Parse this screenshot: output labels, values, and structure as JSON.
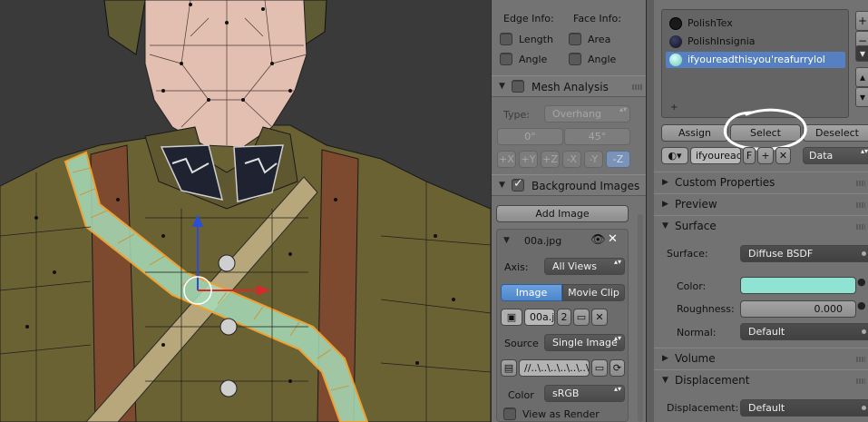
{
  "npanel": {
    "edge_info": "Edge Info:",
    "face_info": "Face Info:",
    "length": "Length",
    "area": "Area",
    "angle_edge": "Angle",
    "angle_face": "Angle",
    "mesh_analysis": "Mesh Analysis",
    "type_label": "Type:",
    "type_value": "Overhang",
    "angle_min": "0°",
    "angle_max": "45°",
    "axes": [
      "+X",
      "+Y",
      "+Z",
      "-X",
      "-Y",
      "-Z"
    ],
    "axis_active": "-Z",
    "background_images": "Background Images",
    "add_image": "Add Image",
    "image_name": "00a.jpg",
    "axis_label": "Axis:",
    "axis_value": "All Views",
    "tab_image": "Image",
    "tab_movie": "Movie Clip",
    "img_block": "00a.j",
    "img_users": "2",
    "source_label": "Source",
    "source_value": "Single Image",
    "filepath": "//..\\..\\..\\..\\..\\..\\",
    "color_label": "Color",
    "color_value": "sRGB",
    "view_as_render": "View as Render"
  },
  "props": {
    "slots": [
      {
        "name": "PolishTex",
        "color": "#1a1a1a"
      },
      {
        "name": "PolishInsignia",
        "color": "#20243a"
      },
      {
        "name": "ifyoureadthisyou'reafurrylol",
        "color": "#8fe3d3"
      }
    ],
    "assign": "Assign",
    "select": "Select",
    "deselect": "Deselect",
    "mat_name": "ifyouread",
    "fake_user": "F",
    "data_value": "Data",
    "custom_properties": "Custom Properties",
    "preview": "Preview",
    "surface_section": "Surface",
    "surface_label": "Surface:",
    "surface_value": "Diffuse BSDF",
    "color_label": "Color:",
    "color_swatch": "#8fe3d3",
    "roughness_label": "Roughness:",
    "roughness_value": "0.000",
    "normal_label": "Normal:",
    "normal_value": "Default",
    "volume": "Volume",
    "displacement_section": "Displacement",
    "displacement_label": "Displacement:",
    "displacement_value": "Default"
  },
  "colors": {
    "uniform": "#6b6234",
    "strap": "#7d4a30",
    "selection": "#a6dcb8",
    "face": "#e2bfb0",
    "accent_blue": "#5680c2"
  }
}
